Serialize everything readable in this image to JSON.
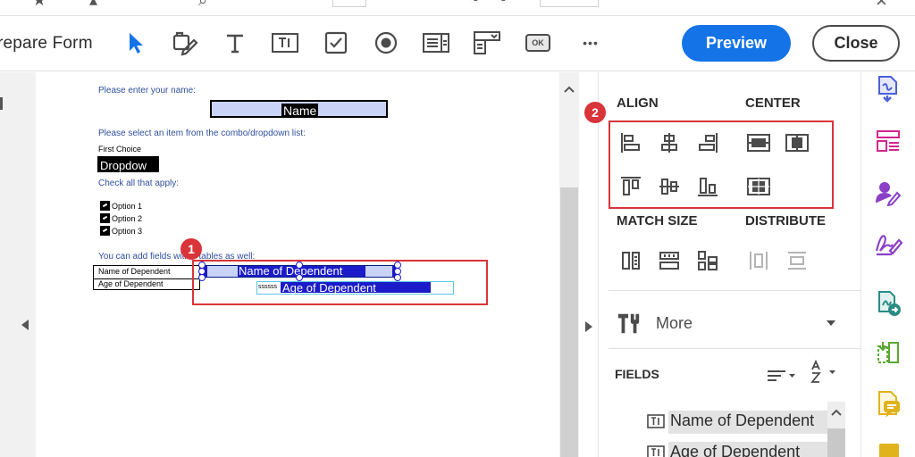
{
  "toolbar": {
    "title": "repare Form",
    "preview_label": "Preview",
    "close_label": "Close",
    "ok_glyph": "OK",
    "more_glyph": "•••",
    "tools": [
      "select-tool",
      "edit-fill-sign-tool",
      "text-tool",
      "text-field-tool",
      "checkbox-tool",
      "radio-button-tool",
      "list-box-tool",
      "dropdown-tool",
      "button-tool",
      "more-tools"
    ]
  },
  "document": {
    "prompt_name": "Please enter your name:",
    "name_field": "Name",
    "prompt_combo": "Please select an item from the combo/dropdown list:",
    "first_choice": "First Choice",
    "dropdown_value": "Dropdow",
    "prompt_check": "Check all that apply:",
    "options": [
      "Option 1",
      "Option 2",
      "Option 3"
    ],
    "prompt_table": "You can add  fields within tables as well:",
    "table_rows": [
      "Name of Dependent",
      "Age of Dependent"
    ],
    "field_dep1": "Name of Dependent",
    "field_dep2": "Age of Dependent",
    "field_dep2_prefix": "ssssss",
    "badge1": "1"
  },
  "panel": {
    "badge2": "2",
    "align": "ALIGN",
    "center": "CENTER",
    "match_size": "MATCH SIZE",
    "distribute": "DISTRIBUTE",
    "more": "More",
    "fields": "FIELDS",
    "field_items": [
      "Name of Dependent",
      "Age  of Dependent"
    ]
  },
  "colors": {
    "accent": "#1473e6",
    "highlight_red": "#d9343a",
    "field_blue": "#1b1bc9",
    "rail_blue": "#4a5fd8",
    "rail_pink": "#d2288e",
    "rail_purple": "#8b3fc8",
    "rail_teal": "#2a8c84",
    "rail_green": "#5aa832",
    "rail_yellow": "#e0b21b"
  }
}
